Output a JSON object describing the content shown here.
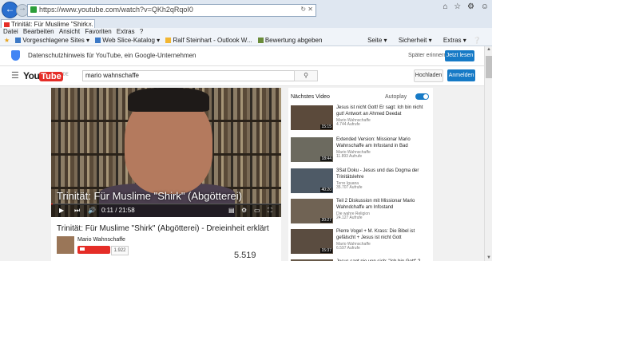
{
  "browser": {
    "url": "https://www.youtube.com/watch?v=QKh2qRqoI0",
    "tab_title": "Trinität: Für Muslime \"Shirk...",
    "menu": [
      "Datei",
      "Bearbeiten",
      "Ansicht",
      "Favoriten",
      "Extras",
      "?"
    ],
    "favorites": [
      "Vorgeschlagene Sites",
      "Web Slice-Katalog",
      "Ralf Steinhart - Outlook W...",
      "Bewertung abgeben"
    ],
    "commands": [
      "Seite",
      "Sicherheit",
      "Extras"
    ]
  },
  "consent": {
    "text": "Datenschutzhinweis für YouTube, ein Google-Unternehmen",
    "later": "Später erinnern",
    "now": "Jetzt lesen"
  },
  "header": {
    "logo_you": "You",
    "logo_tube": "Tube",
    "logo_country": "DE",
    "search_value": "mario wahnschaffe",
    "upload": "Hochladen",
    "signin": "Anmelden"
  },
  "video": {
    "overlay_title": "Trinität: Für Muslime \"Shirk\" (Abgötterei)",
    "time": "0:11 / 21:58",
    "progress": 0.008,
    "title": "Trinität: Für Muslime \"Shirk\" (Abgötterei) - Dreieinheit erklärt",
    "channel": "Mario Wahnschaffe",
    "subscribe": "Abonnieren",
    "subscribers": "1.922",
    "views": "5.519 Aufrufe"
  },
  "sidebar": {
    "header": "Nächstes Video",
    "autoplay": "Autoplay",
    "items": [
      {
        "title": "Jesus ist nicht Gott! Er sagt: Ich bin nicht gut! Antwort an Ahmed Deedat",
        "channel": "Mario Wahnschaffe",
        "views": "4.744 Aufrufe",
        "duration": "15:15"
      },
      {
        "title": "Extended Version: Missionar Mario Wahnschaffe am Infostand in Bad",
        "channel": "Mario Wahnschaffe",
        "views": "11.893 Aufrufe",
        "duration": "18:44"
      },
      {
        "title": "3Sat Doku - Jesus und das Dogma der Trinitätslehre",
        "channel": "Terre Iguana",
        "views": "35.707 Aufrufe",
        "duration": "40:20"
      },
      {
        "title": "Teil 2 Diskussion mit Missionar Mario Wahndchaffe am Infostand",
        "channel": "Die wahre Religion",
        "views": "24.127 Aufrufe",
        "duration": "20:27"
      },
      {
        "title": "Pierre Vogel + M. Krass: Die Bibel ist gefälscht + Jesus ist nicht Gott",
        "channel": "Mario Wahnschaffe",
        "views": "6.597 Aufrufe",
        "duration": "15:37"
      },
      {
        "title": "Jesus sagt nie von sich: \"Ich bin Gott\" ?",
        "channel": "",
        "views": "",
        "duration": ""
      }
    ]
  }
}
